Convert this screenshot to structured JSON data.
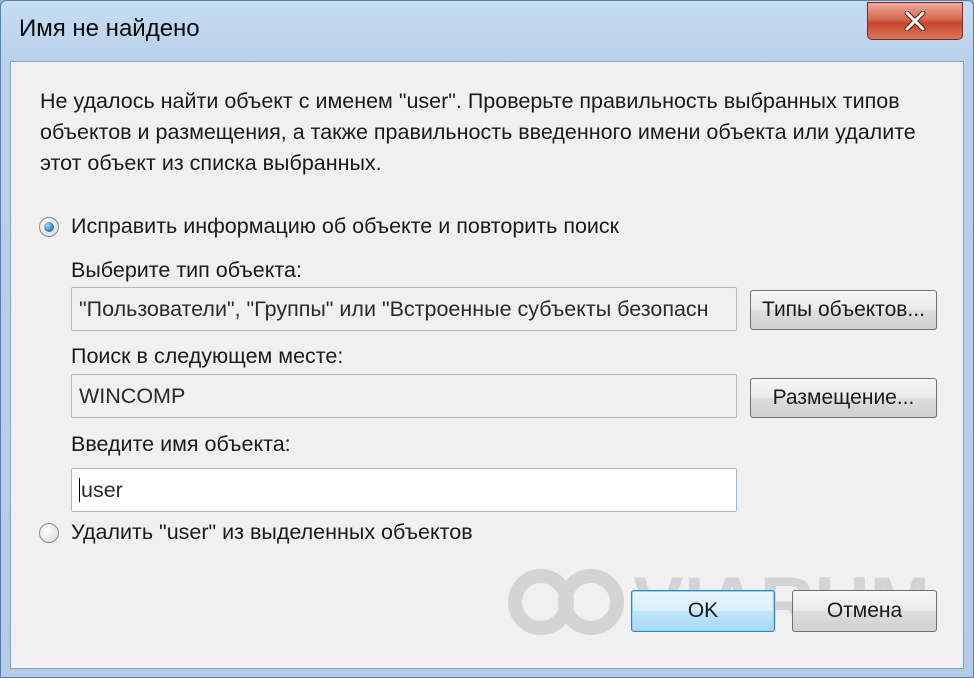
{
  "window": {
    "title": "Имя не найдено"
  },
  "message": "Не удалось найти объект с именем \"user\". Проверьте правильность выбранных типов объектов и размещения, а также правильность введенного имени объекта или удалите этот объект из списка выбранных.",
  "option_fix": {
    "label": "Исправить информацию об объекте и повторить поиск",
    "checked": true
  },
  "object_type": {
    "label": "Выберите тип объекта:",
    "value": "\"Пользователи\", \"Группы\" или \"Встроенные субъекты безопасн",
    "button": "Типы объектов..."
  },
  "location": {
    "label": "Поиск в следующем месте:",
    "value": "WINCOMP",
    "button": "Размещение..."
  },
  "object_name": {
    "label": "Введите имя объекта:",
    "value": "user"
  },
  "option_remove": {
    "label": "Удалить \"user\" из выделенных объектов",
    "checked": false
  },
  "buttons": {
    "ok": "OK",
    "cancel": "Отмена"
  },
  "watermark": {
    "text": "VIARUM"
  },
  "icons": {
    "close": "close-icon"
  }
}
